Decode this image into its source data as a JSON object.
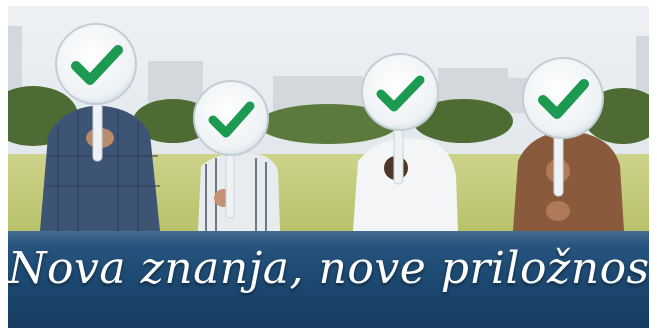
{
  "banner": {
    "slogan": "Nova znanja, nove priložnosti."
  },
  "colors": {
    "banner_blue": "#1d4a73",
    "check_green": "#1c9a52",
    "sign_face": "#f2f5f7",
    "sky": "#e4e8ec",
    "grass": "#c9cf7e"
  },
  "icons": [
    "checkmark-icon",
    "checkmark-icon",
    "checkmark-icon",
    "checkmark-icon"
  ]
}
